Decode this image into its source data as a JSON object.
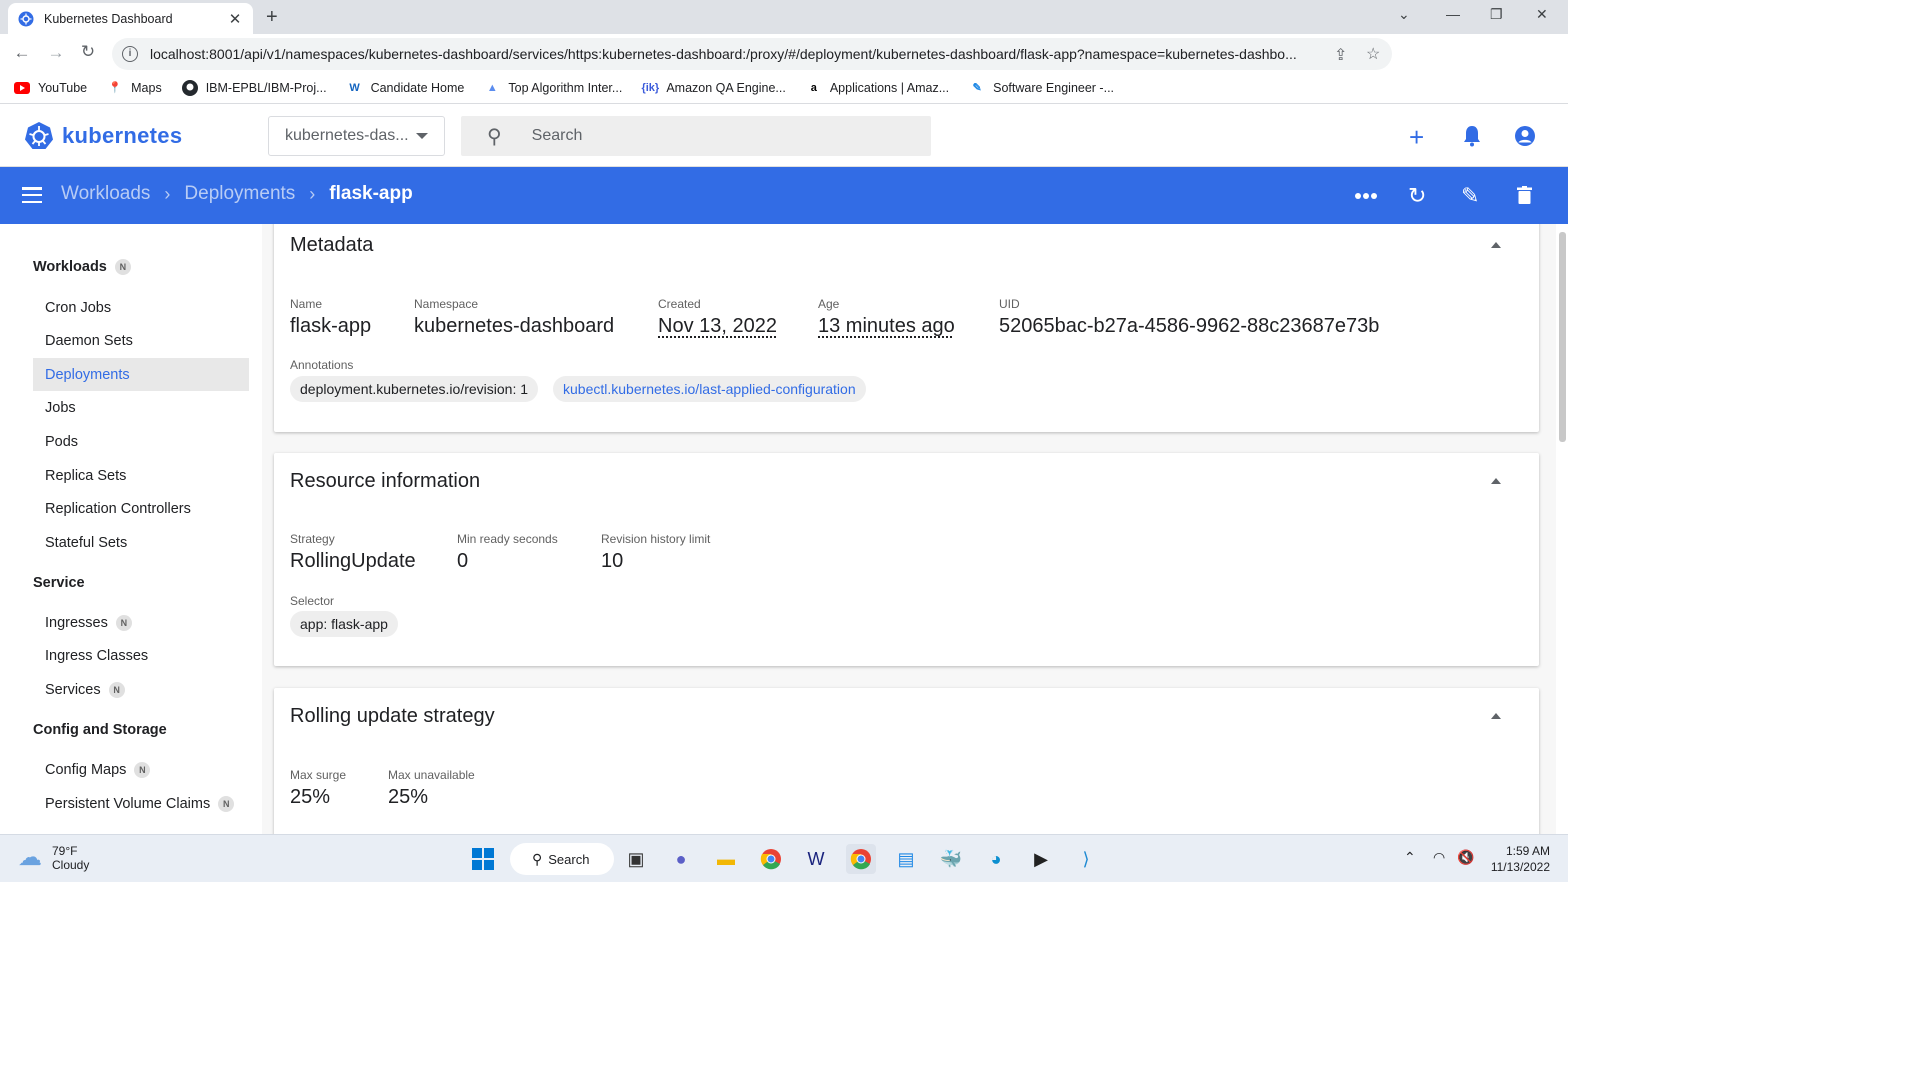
{
  "browser": {
    "tab_title": "Kubernetes Dashboard",
    "url": "localhost:8001/api/v1/namespaces/kubernetes-dashboard/services/https:kubernetes-dashboard:/proxy/#/deployment/kubernetes-dashboard/flask-app?namespace=kubernetes-dashbo...",
    "bookmarks": [
      {
        "label": "YouTube",
        "icon": "youtube-icon",
        "color": "#ff0000"
      },
      {
        "label": "Maps",
        "icon": "maps-icon",
        "color": "#34a853"
      },
      {
        "label": "IBM-EPBL/IBM-Proj...",
        "icon": "github-icon",
        "color": "#24292e"
      },
      {
        "label": "Candidate Home",
        "icon": "workday-icon",
        "color": "#f5a623"
      },
      {
        "label": "Top Algorithm Inter...",
        "icon": "chart-icon",
        "color": "#5b8def"
      },
      {
        "label": "Amazon QA Engine...",
        "icon": "interviewkickstart-icon",
        "color": "#3b5bdb"
      },
      {
        "label": "Applications | Amaz...",
        "icon": "amazon-icon",
        "color": "#000000"
      },
      {
        "label": "Software Engineer -...",
        "icon": "pen-icon",
        "color": "#1e88e5"
      }
    ]
  },
  "header": {
    "brand": "kubernetes",
    "namespace_selected": "kubernetes-das...",
    "search_placeholder": "Search",
    "accent": "#326ce5"
  },
  "toolbar": {
    "breadcrumbs": [
      "Workloads",
      "Deployments",
      "flask-app"
    ]
  },
  "sidebar": {
    "groups": [
      {
        "label": "Workloads",
        "badge": "N"
      },
      {
        "label": "Service"
      },
      {
        "label": "Config and Storage"
      }
    ],
    "items": [
      {
        "label": "Cron Jobs"
      },
      {
        "label": "Daemon Sets"
      },
      {
        "label": "Deployments",
        "active": true
      },
      {
        "label": "Jobs"
      },
      {
        "label": "Pods"
      },
      {
        "label": "Replica Sets"
      },
      {
        "label": "Replication Controllers"
      },
      {
        "label": "Stateful Sets"
      },
      {
        "label": "Ingresses",
        "badge": "N"
      },
      {
        "label": "Ingress Classes"
      },
      {
        "label": "Services",
        "badge": "N"
      },
      {
        "label": "Config Maps",
        "badge": "N"
      },
      {
        "label": "Persistent Volume Claims",
        "badge": "N"
      }
    ]
  },
  "metadata": {
    "title": "Metadata",
    "fields": [
      {
        "label": "Name",
        "value": "flask-app"
      },
      {
        "label": "Namespace",
        "value": "kubernetes-dashboard"
      },
      {
        "label": "Created",
        "value": "Nov 13, 2022"
      },
      {
        "label": "Age",
        "value": "13 minutes ago"
      },
      {
        "label": "UID",
        "value": "52065bac-b27a-4586-9962-88c23687e73b"
      }
    ],
    "annotations_label": "Annotations",
    "annotations": [
      "deployment.kubernetes.io/revision: 1",
      "kubectl.kubernetes.io/last-applied-configuration"
    ]
  },
  "resource_info": {
    "title": "Resource information",
    "fields": [
      {
        "label": "Strategy",
        "value": "RollingUpdate"
      },
      {
        "label": "Min ready seconds",
        "value": "0"
      },
      {
        "label": "Revision history limit",
        "value": "10"
      }
    ],
    "selector_label": "Selector",
    "selector": "app: flask-app"
  },
  "rolling_update": {
    "title": "Rolling update strategy",
    "fields": [
      {
        "label": "Max surge",
        "value": "25%"
      },
      {
        "label": "Max unavailable",
        "value": "25%"
      }
    ]
  },
  "taskbar": {
    "temperature": "79°F",
    "weather": "Cloudy",
    "search_label": "Search",
    "time": "1:59 AM",
    "date": "11/13/2022"
  }
}
